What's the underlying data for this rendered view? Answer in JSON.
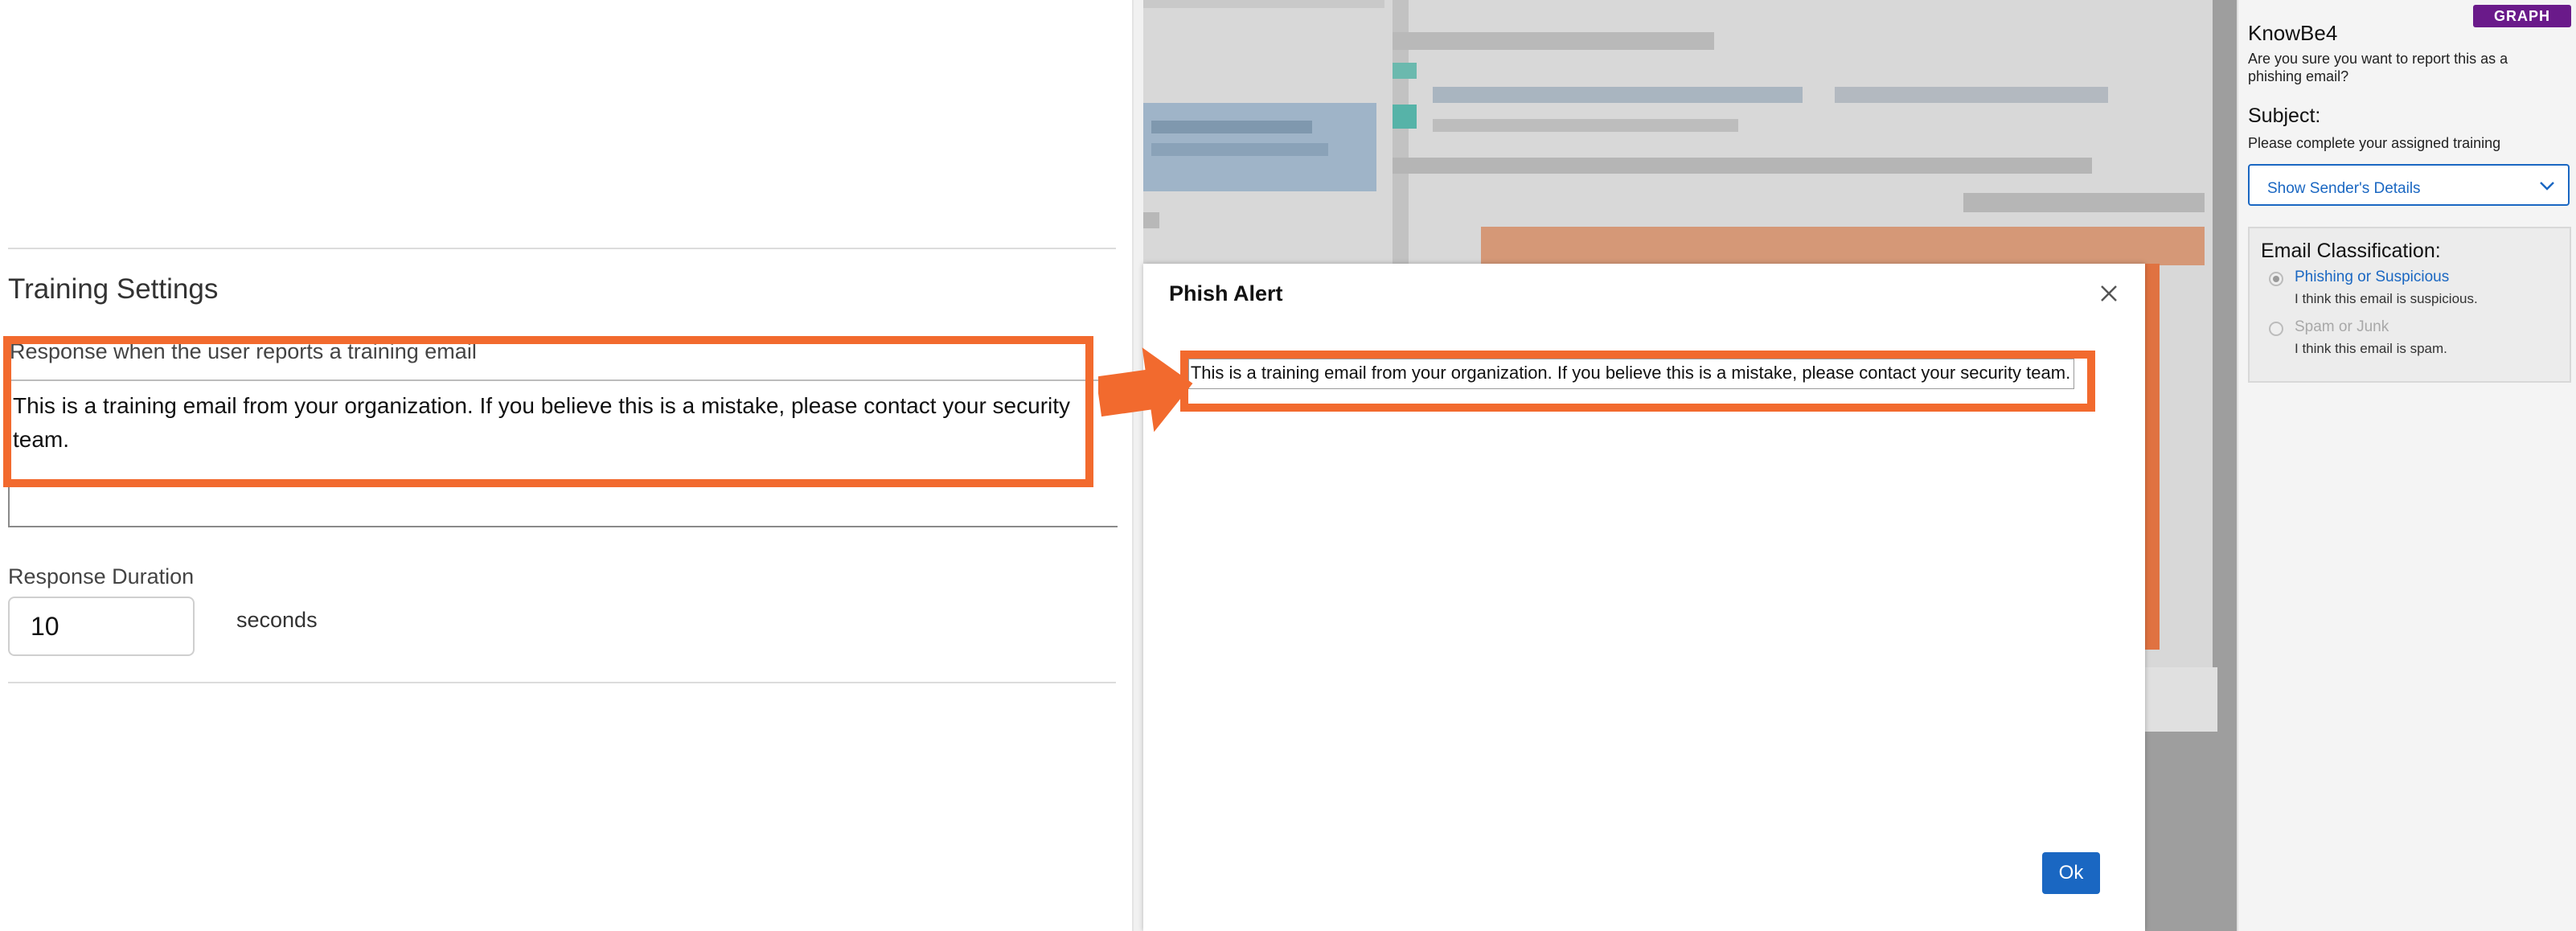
{
  "training_settings": {
    "section_title": "Training Settings",
    "response_label": "Response when the user reports a training email",
    "response_text": "This is a training email from your organization. If you believe this is a mistake, please contact your security team.",
    "duration_label": "Response Duration",
    "duration_value": "10",
    "duration_units": "seconds"
  },
  "dialog": {
    "title": "Phish Alert",
    "message": "This is a training email from your organization. If you believe this is a mistake, please contact your security team.",
    "ok_label": "Ok",
    "close_icon": "close-icon"
  },
  "addin": {
    "badge": "GRAPH",
    "title": "KnowBe4",
    "prompt": "Are you sure you want to report this as a phishing email?",
    "subject_label": "Subject:",
    "subject_value": "Please complete your assigned training",
    "sender_button_label": "Show Sender's Details",
    "classification_title": "Email Classification:",
    "options": [
      {
        "label": "Phishing or Suspicious",
        "description": "I think this email is suspicious."
      },
      {
        "label": "Spam or Junk",
        "description": "I think this email is spam."
      }
    ]
  },
  "colors": {
    "highlight": "#f26a2e",
    "primary": "#1a67c2",
    "badge": "#6a1a8a"
  }
}
